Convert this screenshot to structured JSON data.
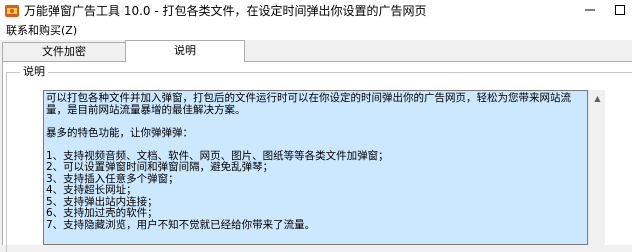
{
  "window": {
    "title": "万能弹窗广告工具 10.0 - 打包各类文件，在设定时间弹出你设置的广告网页",
    "icon": "app-logo-icon"
  },
  "controls": {
    "minimize_icon": "minimize-icon",
    "maximize_icon": "maximize-icon"
  },
  "menu": {
    "items": [
      {
        "label": "联系和购买(Z)"
      }
    ]
  },
  "tabs": [
    {
      "label": "文件加密",
      "selected": false
    },
    {
      "label": "说明",
      "selected": true
    }
  ],
  "panel": {
    "group_label": "说明",
    "description": "可以打包各种文件并加入弹窗，打包后的文件运行时可以在你设定的时间弹出你的广告网页，轻松为您带来网站流量，是目前网站流量暴增的最佳解决方案。\n\n暴多的特色功能，让你弹弹弹：\n\n1、支持视频音频、文档、软件、网页、图片、图纸等等各类文件加弹窗；\n2、可以设置弹窗时间和弹窗间隔，避免乱弹琴；\n3、支持插入任意多个弹窗；\n4、支持超长网址；\n5、支持弹出站内连接；\n6、支持加过壳的软件；\n7、支持隐藏浏览，用户不知不觉就已经给你带来了流量。",
    "selection_color": "#cce8ff"
  }
}
